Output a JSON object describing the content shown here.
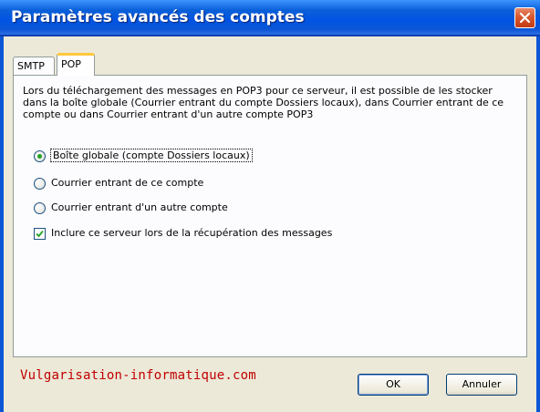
{
  "window": {
    "title": "Paramètres avancés des comptes"
  },
  "tabs": [
    {
      "label": "SMTP",
      "selected": false
    },
    {
      "label": "POP",
      "selected": true
    }
  ],
  "pop_panel": {
    "description": "Lors du téléchargement des messages en POP3 pour ce serveur, il est possible de les stocker dans la boîte globale (Courrier entrant du compte Dossiers locaux), dans Courrier entrant de ce compte ou dans Courrier entrant d'un autre compte POP3",
    "options": [
      {
        "label": "Boîte globale (compte Dossiers locaux)",
        "checked": true
      },
      {
        "label": "Courrier entrant de ce compte",
        "checked": false
      },
      {
        "label": "Courrier entrant d'un autre compte",
        "checked": false
      }
    ],
    "include_server": {
      "label": "Inclure ce serveur lors de la récupération des messages",
      "checked": true
    }
  },
  "watermark": "Vulgarisation-informatique.com",
  "buttons": {
    "ok": "OK",
    "cancel": "Annuler"
  },
  "colors": {
    "titlebar": "#0054e3",
    "dialog_bg": "#ece9d8",
    "watermark": "#c00000",
    "tab_highlight": "#ffc83c"
  }
}
